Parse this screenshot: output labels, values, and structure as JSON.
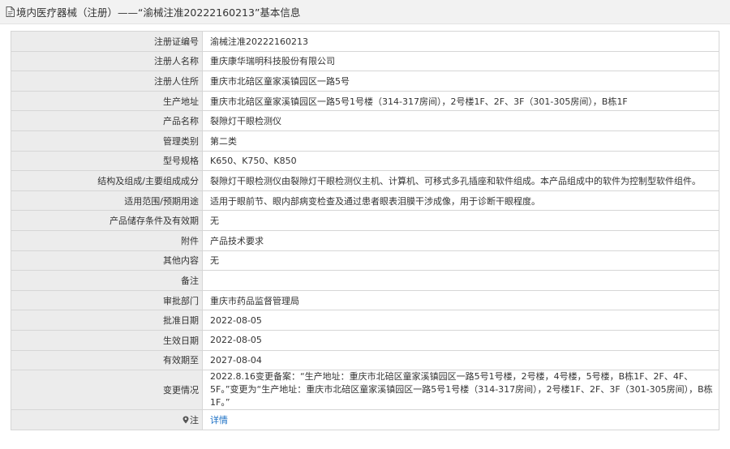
{
  "header": {
    "title": "境内医疗器械（注册）——“渝械注准20222160213”基本信息"
  },
  "rows": [
    {
      "label": "注册证编号",
      "value": "渝械注准20222160213"
    },
    {
      "label": "注册人名称",
      "value": "重庆康华瑞明科技股份有限公司"
    },
    {
      "label": "注册人住所",
      "value": "重庆市北碚区童家溪镇园区一路5号"
    },
    {
      "label": "生产地址",
      "value": "重庆市北碚区童家溪镇园区一路5号1号楼（314-317房间），2号楼1F、2F、3F（301-305房间），B栋1F"
    },
    {
      "label": "产品名称",
      "value": "裂隙灯干眼检测仪"
    },
    {
      "label": "管理类别",
      "value": "第二类"
    },
    {
      "label": "型号规格",
      "value": "K650、K750、K850"
    },
    {
      "label": "结构及组成/主要组成成分",
      "value": "裂隙灯干眼检测仪由裂隙灯干眼检测仪主机、计算机、可移式多孔插座和软件组成。本产品组成中的软件为控制型软件组件。"
    },
    {
      "label": "适用范围/预期用途",
      "value": "适用于眼前节、眼内部病变检查及通过患者眼表泪膜干涉成像，用于诊断干眼程度。"
    },
    {
      "label": "产品储存条件及有效期",
      "value": "无"
    },
    {
      "label": "附件",
      "value": "产品技术要求"
    },
    {
      "label": "其他内容",
      "value": "无"
    },
    {
      "label": "备注",
      "value": ""
    },
    {
      "label": "审批部门",
      "value": "重庆市药品监督管理局"
    },
    {
      "label": "批准日期",
      "value": "2022-08-05"
    },
    {
      "label": "生效日期",
      "value": "2022-08-05"
    },
    {
      "label": "有效期至",
      "value": "2027-08-04"
    },
    {
      "label": "变更情况",
      "value": "2022.8.16变更备案：“生产地址：重庆市北碚区童家溪镇园区一路5号1号楼，2号楼，4号楼，5号楼，B栋1F、2F、4F、5F。”变更为“生产地址：重庆市北碚区童家溪镇园区一路5号1号楼（314-317房间），2号楼1F、2F、3F（301-305房间），B栋1F。”"
    }
  ],
  "note": {
    "icon": "pin-icon",
    "label": "注",
    "link": "详情"
  }
}
